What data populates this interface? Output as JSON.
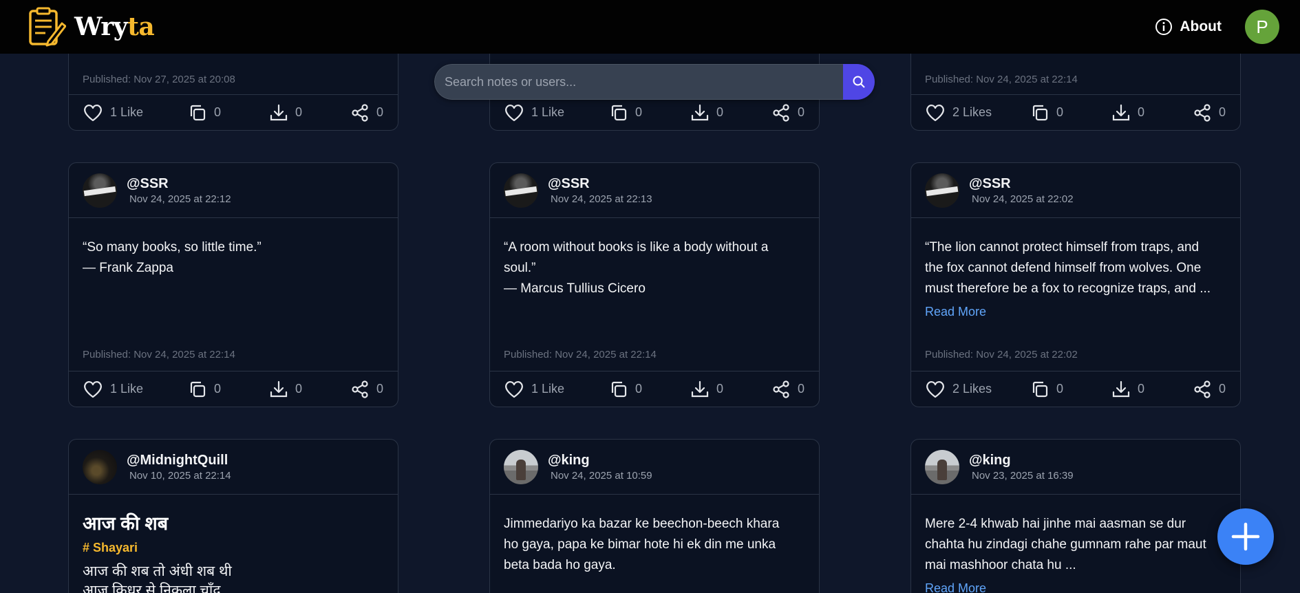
{
  "header": {
    "brand_prefix": "Wry",
    "brand_accent": "ta",
    "about_label": "About",
    "user_initial": "P"
  },
  "search": {
    "placeholder": "Search notes or users..."
  },
  "cards": [
    {
      "published": "Published: Nov 27, 2025 at 20:08",
      "likes": "1 Like",
      "copies": "0",
      "downloads": "0",
      "shares": "0"
    },
    {
      "published": "",
      "likes": "1 Like",
      "copies": "0",
      "downloads": "0",
      "shares": "0"
    },
    {
      "published": "Published: Nov 24, 2025 at 22:14",
      "likes": "2 Likes",
      "copies": "0",
      "downloads": "0",
      "shares": "0"
    },
    {
      "username": "@SSR",
      "date": "Nov 24, 2025 at 22:12",
      "lines": [
        "“So many books, so little time.”",
        "— Frank Zappa"
      ],
      "read_more": "",
      "published": "Published: Nov 24, 2025 at 22:14",
      "likes": "1 Like",
      "copies": "0",
      "downloads": "0",
      "shares": "0"
    },
    {
      "username": "@SSR",
      "date": "Nov 24, 2025 at 22:13",
      "lines": [
        "“A room without books is like a body without a",
        "soul.”",
        "— Marcus Tullius Cicero"
      ],
      "read_more": "",
      "published": "Published: Nov 24, 2025 at 22:14",
      "likes": "1 Like",
      "copies": "0",
      "downloads": "0",
      "shares": "0"
    },
    {
      "username": "@SSR",
      "date": "Nov 24, 2025 at 22:02",
      "lines": [
        "“The lion cannot protect himself from traps, and",
        "the fox cannot defend himself from wolves. One",
        "must therefore be a fox to recognize traps, and ..."
      ],
      "read_more": "Read More",
      "published": "Published: Nov 24, 2025 at 22:02",
      "likes": "2 Likes",
      "copies": "0",
      "downloads": "0",
      "shares": "0"
    },
    {
      "username": "@MidnightQuill",
      "date": "Nov 10, 2025 at 22:14",
      "title": "आज की शब",
      "tag": "# Shayari",
      "lines": [
        "आज की शब तो अंधी शब थी",
        "आज किधर से निकला चाँद"
      ]
    },
    {
      "username": "@king",
      "date": "Nov 24, 2025 at 10:59",
      "lines": [
        "Jimmedariyo ka bazar ke beechon-beech khara",
        "ho gaya, papa ke bimar hote hi ek din me unka",
        "beta bada ho gaya."
      ]
    },
    {
      "username": "@king",
      "date": "Nov 23, 2025 at 16:39",
      "lines": [
        "Mere 2-4 khwab hai jinhe mai aasman se dur",
        "chahta hu zindagi chahe gumnam rahe par maut",
        "mai mashhoor chata hu ..."
      ],
      "read_more": "Read More"
    }
  ]
}
